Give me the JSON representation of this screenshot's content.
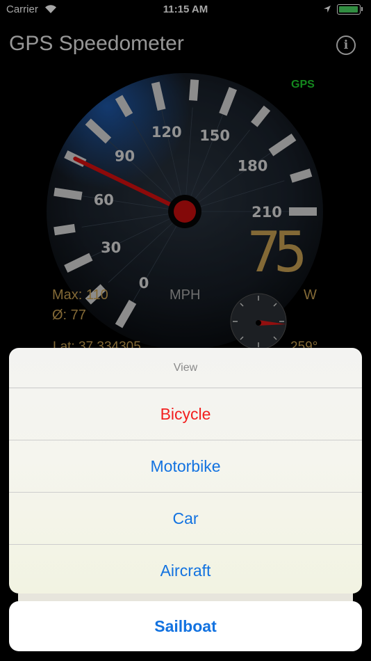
{
  "status_bar": {
    "carrier": "Carrier",
    "time": "11:15 AM",
    "battery_level": 1.0,
    "battery_color": "#4cd964"
  },
  "app": {
    "title": "GPS Speedometer",
    "info_label": "i",
    "gps_status": "GPS",
    "gps_color": "#1fcf2f"
  },
  "gauge": {
    "ticks": [
      "0",
      "30",
      "60",
      "90",
      "120",
      "150",
      "180",
      "210"
    ],
    "needle_value": 75,
    "needle_color": "#d91010",
    "unit": "MPH"
  },
  "readout": {
    "speed": "75",
    "max": "Max: 110",
    "average": "Ø: 77",
    "heading": "W",
    "latitude": "Lat: 37.334305",
    "bearing": "259°",
    "accent_color": "#c9a253"
  },
  "action_sheet": {
    "title": "View",
    "items": [
      "Bicycle",
      "Motorbike",
      "Car",
      "Aircraft"
    ],
    "cancel_label": "Sailboat",
    "destructive_color": "#f21f1f",
    "action_color": "#1272e0"
  }
}
